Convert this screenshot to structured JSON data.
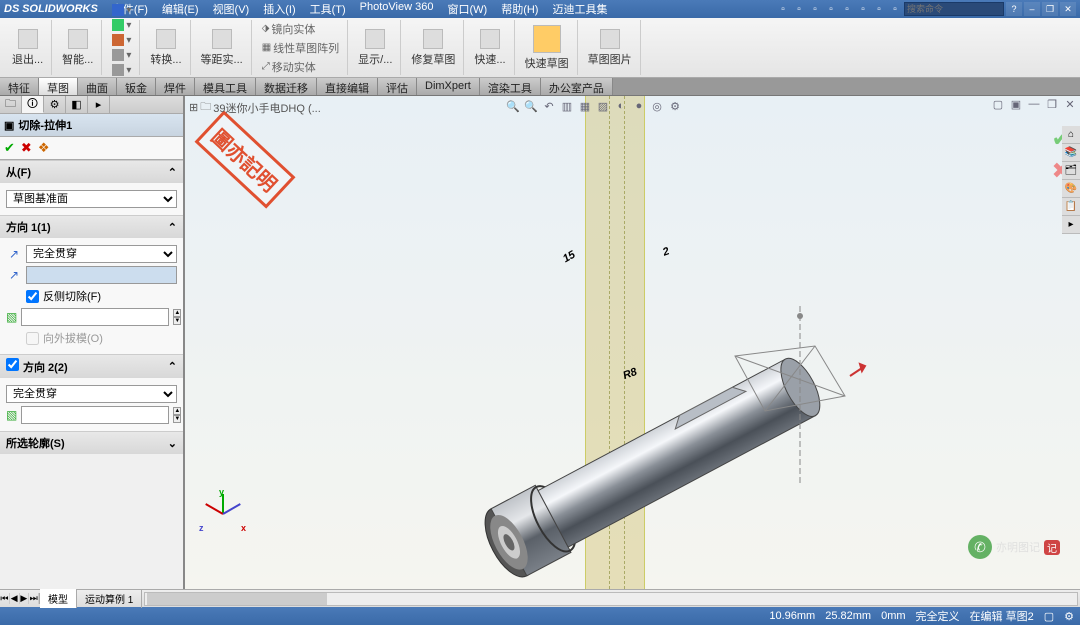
{
  "app": {
    "name": "SOLIDWORKS",
    "logo_prefix": "DS"
  },
  "menus": [
    "文件(F)",
    "编辑(E)",
    "视图(V)",
    "插入(I)",
    "工具(T)",
    "PhotoView 360",
    "窗口(W)",
    "帮助(H)",
    "迈迪工具集"
  ],
  "search": {
    "placeholder": "搜索命令"
  },
  "ribbon": {
    "exit": "退出...",
    "smart": "智能...",
    "convert": "转换...",
    "equidist": "等距实...",
    "mirror": "镜向实体",
    "pattern": "线性草图阵列",
    "move": "移动实体",
    "show": "显示/...",
    "repair": "修复草图",
    "quick": "快速...",
    "quicksketch": "快速草图",
    "sketchpic": "草图图片"
  },
  "cmd_tabs": [
    "特征",
    "草图",
    "曲面",
    "钣金",
    "焊件",
    "模具工具",
    "数据迁移",
    "直接编辑",
    "评估",
    "DimXpert",
    "渲染工具",
    "办公室产品"
  ],
  "active_cmd_tab": 1,
  "document": {
    "name": "39迷你小手电DHQ  (..."
  },
  "feature": {
    "title": "切除-拉伸1",
    "from_section": "从(F)",
    "from_option": "草图基准面",
    "dir1_section": "方向 1(1)",
    "dir1_end": "完全贯穿",
    "dir1_depth": "",
    "reverse_cut": "反侧切除(F)",
    "draft_value": "",
    "draft_out": "向外拔模(O)",
    "dir2_section": "方向 2(2)",
    "dir2_end": "完全贯穿",
    "dir2_value": "",
    "contours": "所选轮廓(S)"
  },
  "dimensions": {
    "d1": "15",
    "d2": "2",
    "d3": "R8"
  },
  "triad": {
    "x": "x",
    "y": "y",
    "z": "z"
  },
  "bottom_tabs": [
    "模型",
    "运动算例 1"
  ],
  "status": {
    "c1": "10.96mm",
    "c2": "25.82mm",
    "c3": "0mm",
    "state": "完全定义",
    "mode": "在编辑 草图2"
  },
  "watermark": {
    "text": "亦明图记",
    "badge": "记"
  },
  "stamp": "圖亦記明"
}
